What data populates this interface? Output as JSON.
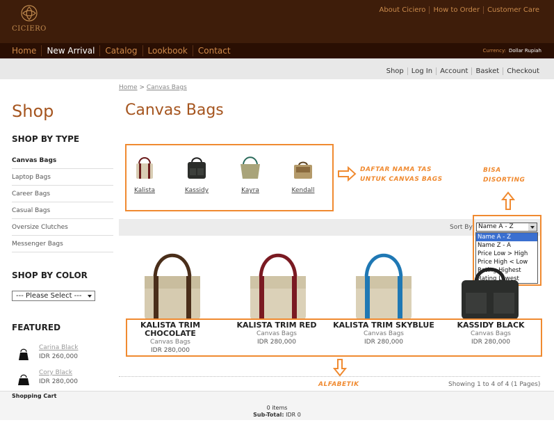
{
  "brand": {
    "name": "CICIERO"
  },
  "top_links": [
    "About Ciciero",
    "How to Order",
    "Customer Care"
  ],
  "nav": {
    "items": [
      "Home",
      "New Arrival",
      "Catalog",
      "Lookbook",
      "Contact"
    ],
    "active": "New Arrival"
  },
  "currency": {
    "label": "Currency:",
    "value": "Dollar  Rupiah"
  },
  "account_links": [
    "Shop",
    "Log In",
    "Account",
    "Basket",
    "Checkout"
  ],
  "sidebar": {
    "title": "Shop",
    "type_heading": "SHOP BY TYPE",
    "types": [
      "Canvas Bags",
      "Laptop Bags",
      "Career Bags",
      "Casual Bags",
      "Oversize Clutches",
      "Messenger Bags"
    ],
    "color_heading": "SHOP BY COLOR",
    "color_select": "--- Please Select ---",
    "featured_heading": "FEATURED",
    "featured": [
      {
        "name": "Carina Black",
        "price": "IDR 260,000"
      },
      {
        "name": "Cory Black",
        "price": "IDR 280,000"
      }
    ]
  },
  "breadcrumb": {
    "home": "Home",
    "sep": " > ",
    "current": "Canvas Bags"
  },
  "page_title": "Canvas Bags",
  "mini_products": [
    "Kalista",
    "Kassidy",
    "Kayra",
    "Kendall"
  ],
  "annotations": {
    "list_note_1": "DAFTAR NAMA TAS",
    "list_note_2": "UNTUK CANVAS BAGS",
    "sort_note_1": "BISA",
    "sort_note_2": "DISORTING",
    "alpha_note": "ALFABETIK"
  },
  "sort": {
    "label": "Sort By:",
    "selected": "Name A - Z",
    "options": [
      "Name A - Z",
      "Name Z - A",
      "Price Low > High",
      "Price High < Low",
      "Rating Highest",
      "Rating Lowest"
    ]
  },
  "products": [
    {
      "name": "KALISTA TRIM CHOCOLATE",
      "category": "Canvas Bags",
      "price": "IDR 280,000"
    },
    {
      "name": "KALISTA TRIM RED",
      "category": "Canvas Bags",
      "price": "IDR 280,000"
    },
    {
      "name": "KALISTA TRIM SKYBLUE",
      "category": "Canvas Bags",
      "price": "IDR 280,000"
    },
    {
      "name": "KASSIDY BLACK",
      "category": "Canvas Bags",
      "price": "IDR 280,000"
    }
  ],
  "showing": "Showing 1 to 4 of 4 (1 Pages)",
  "cart": {
    "title": "Shopping Cart",
    "items": "0 items",
    "subtotal_label": "Sub-Total:",
    "subtotal": "IDR 0"
  },
  "colors": {
    "header_bg": "#3e1d0a",
    "nav_bg": "#2a0f03",
    "accent": "#a5551f",
    "annotation": "#f08a30",
    "link": "#c98a4c"
  }
}
